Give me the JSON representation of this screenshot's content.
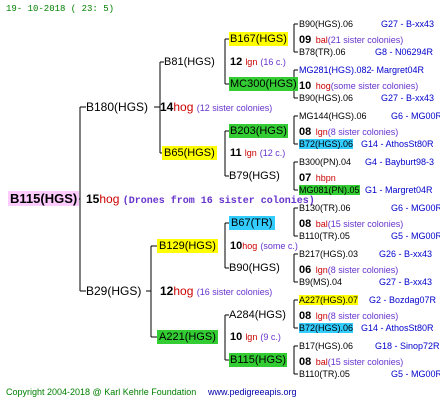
{
  "header": {
    "date": "19- 10-2018 ( 23: 5)"
  },
  "root": {
    "name": "B115(HGS)",
    "num": "15",
    "word": "hog",
    "note": "(Drones from 16 sister colonies)"
  },
  "gen1": {
    "upper": {
      "name": "B180(HGS)",
      "num": "14",
      "word": "hog",
      "note": "(12 sister colonies)"
    },
    "lower": {
      "name": "B29(HGS)",
      "num": "12",
      "word": "hog",
      "note": "(16 sister colonies)"
    }
  },
  "gen2": {
    "a": {
      "name": "B81(HGS)",
      "num": "12",
      "word": "lgn",
      "note": "(16 c.)"
    },
    "b": {
      "name": "B65(HGS)",
      "num": "11",
      "word": "lgn",
      "note": "(12 c.)"
    },
    "c": {
      "name": "B129(HGS)",
      "num": "10",
      "word": "hog",
      "note": "(some c.)"
    },
    "d": {
      "name": "A221(HGS)",
      "num": "10",
      "word": "lgn",
      "note": "(9 c.)"
    }
  },
  "gen3": {
    "a": {
      "name": "B167(HGS)",
      "num": "09",
      "word": "bal",
      "note": "(21 sister colonies)"
    },
    "b": {
      "name": "MC300(HGS)",
      "num": "10",
      "word": "hog",
      "note": "(some sister colonies)"
    },
    "c": {
      "name": "B203(HGS)",
      "num": "08",
      "word": "lgn",
      "note": "(8 sister colonies)"
    },
    "d": {
      "name": "B79(HGS)",
      "num": "07",
      "word": "hbpn",
      "note": ""
    },
    "e": {
      "name": "B67(TR)",
      "num": "08",
      "word": "bal",
      "note": "(15 sister colonies)"
    },
    "f": {
      "name": "B90(HGS)",
      "num": "06",
      "word": "lgn",
      "note": "(8 sister colonies)"
    },
    "g": {
      "name": "A284(HGS)",
      "num": "08",
      "word": "lgn",
      "note": "(8 sister colonies)"
    },
    "h": {
      "name": "B115(HGS)",
      "num": "08",
      "word": "bal",
      "note": "(15 sister colonies)"
    }
  },
  "gen4": {
    "a1": {
      "left": "B90(HGS).06",
      "right": "G27 - B-xx43"
    },
    "a2": {
      "left": "B78(TR).06",
      "right": "G8 - N06294R"
    },
    "b1": {
      "left": "MG281(HGS).082",
      "right": "- Margret04R"
    },
    "b2": {
      "left": "B90(HGS).06",
      "right": "G27 - B-xx43"
    },
    "c1": {
      "left": "MG144(HGS).06",
      "right": "G6 - MG00R"
    },
    "c2": {
      "left": "B72(HGS).06",
      "right": "G14 - AthosSt80R"
    },
    "d1": {
      "left": "B300(PN).04",
      "right": "G4 - Bayburt98-3"
    },
    "d2": {
      "left": "MG081(PN).05",
      "right": "G1 - Margret04R"
    },
    "e1": {
      "left": "B130(TR).06",
      "right": "G6 - MG00R"
    },
    "e2": {
      "left": "B110(TR).05",
      "right": "G5 - MG00R"
    },
    "f1": {
      "left": "B217(HGS).03",
      "right": "G26 - B-xx43"
    },
    "f2": {
      "left": "B9(MS).04",
      "right": "G27 - B-xx43"
    },
    "g1": {
      "left": "A227(HGS).07",
      "right": "G2 - Bozdag07R"
    },
    "g2": {
      "left": "B72(HGS).06",
      "right": "G14 - AthosSt80R"
    },
    "h1": {
      "left": "B17(HGS).06",
      "right": "G18 - Sinop72R"
    },
    "h2": {
      "left": "B110(TR).05",
      "right": "G5 - MG00R"
    }
  },
  "footer": {
    "copyright": "Copyright 2004-2018 @ Karl Kehrle Foundation",
    "url": "www.pedigreeapis.org"
  },
  "colors": {
    "yellow": "#ffff00",
    "green": "#33cc33",
    "cyan": "#33ccff",
    "pink": "#ffccff",
    "red": "#cc0000",
    "purple": "#6633cc",
    "blue": "#0000cc"
  }
}
